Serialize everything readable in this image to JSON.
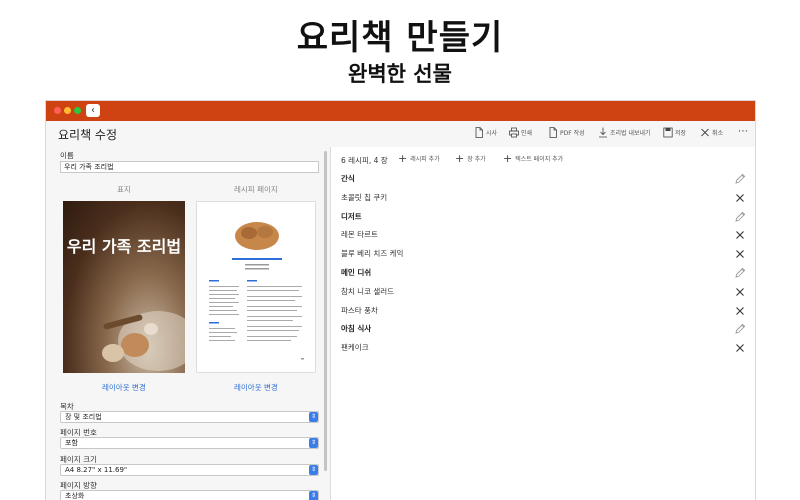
{
  "hero": {
    "title": "요리책 만들기",
    "subtitle": "완벽한 선물"
  },
  "window": {
    "title": "요리책 수정",
    "toolbar": [
      {
        "label": "시사",
        "icon": "document-icon"
      },
      {
        "label": "인쇄",
        "icon": "printer-icon"
      },
      {
        "label": "PDF 작성",
        "icon": "pdf-icon"
      },
      {
        "label": "조리법 내보내기",
        "icon": "export-icon"
      },
      {
        "label": "저장",
        "icon": "save-icon"
      },
      {
        "label": "취소",
        "icon": "close-icon"
      }
    ],
    "more": "⋯"
  },
  "left": {
    "name_label": "이름",
    "name_value": "우리 가족 조리법",
    "cover_header": "표지",
    "recipe_page_header": "레시피 페이지",
    "cover_text": "우리 가족 조리법",
    "change_layout_1": "레이아웃 변경",
    "change_layout_2": "레이아웃 변경",
    "toc_label": "목차",
    "toc_value": "장 및 조리법",
    "page_number_label": "페이지 번호",
    "page_number_value": "포함",
    "page_size_label": "페이지 크기",
    "page_size_value": "A4 8.27\" x 11.69\"",
    "orientation_label": "페이지 방향",
    "orientation_value": "초상화"
  },
  "right": {
    "count": "6 레시피, 4 장",
    "add_buttons": [
      "레시피 추가",
      "장 추가",
      "텍스트 페이지 추가"
    ],
    "rows": [
      {
        "type": "chapter",
        "label": "간식"
      },
      {
        "type": "recipe",
        "label": "초콜릿 칩 쿠키"
      },
      {
        "type": "chapter",
        "label": "디저트"
      },
      {
        "type": "recipe",
        "label": "레몬 타르트"
      },
      {
        "type": "recipe",
        "label": "블루 베리 치즈 케익"
      },
      {
        "type": "chapter",
        "label": "메인 디쉬"
      },
      {
        "type": "recipe",
        "label": "참치 니코 샐러드"
      },
      {
        "type": "recipe",
        "label": "파스타 풍차"
      },
      {
        "type": "chapter",
        "label": "아침 식사"
      },
      {
        "type": "recipe",
        "label": "팬케이크"
      }
    ]
  },
  "colors": {
    "titlebar": "#cf4312",
    "accent": "#2d6fd6",
    "select_button": "#3b7ee8"
  }
}
